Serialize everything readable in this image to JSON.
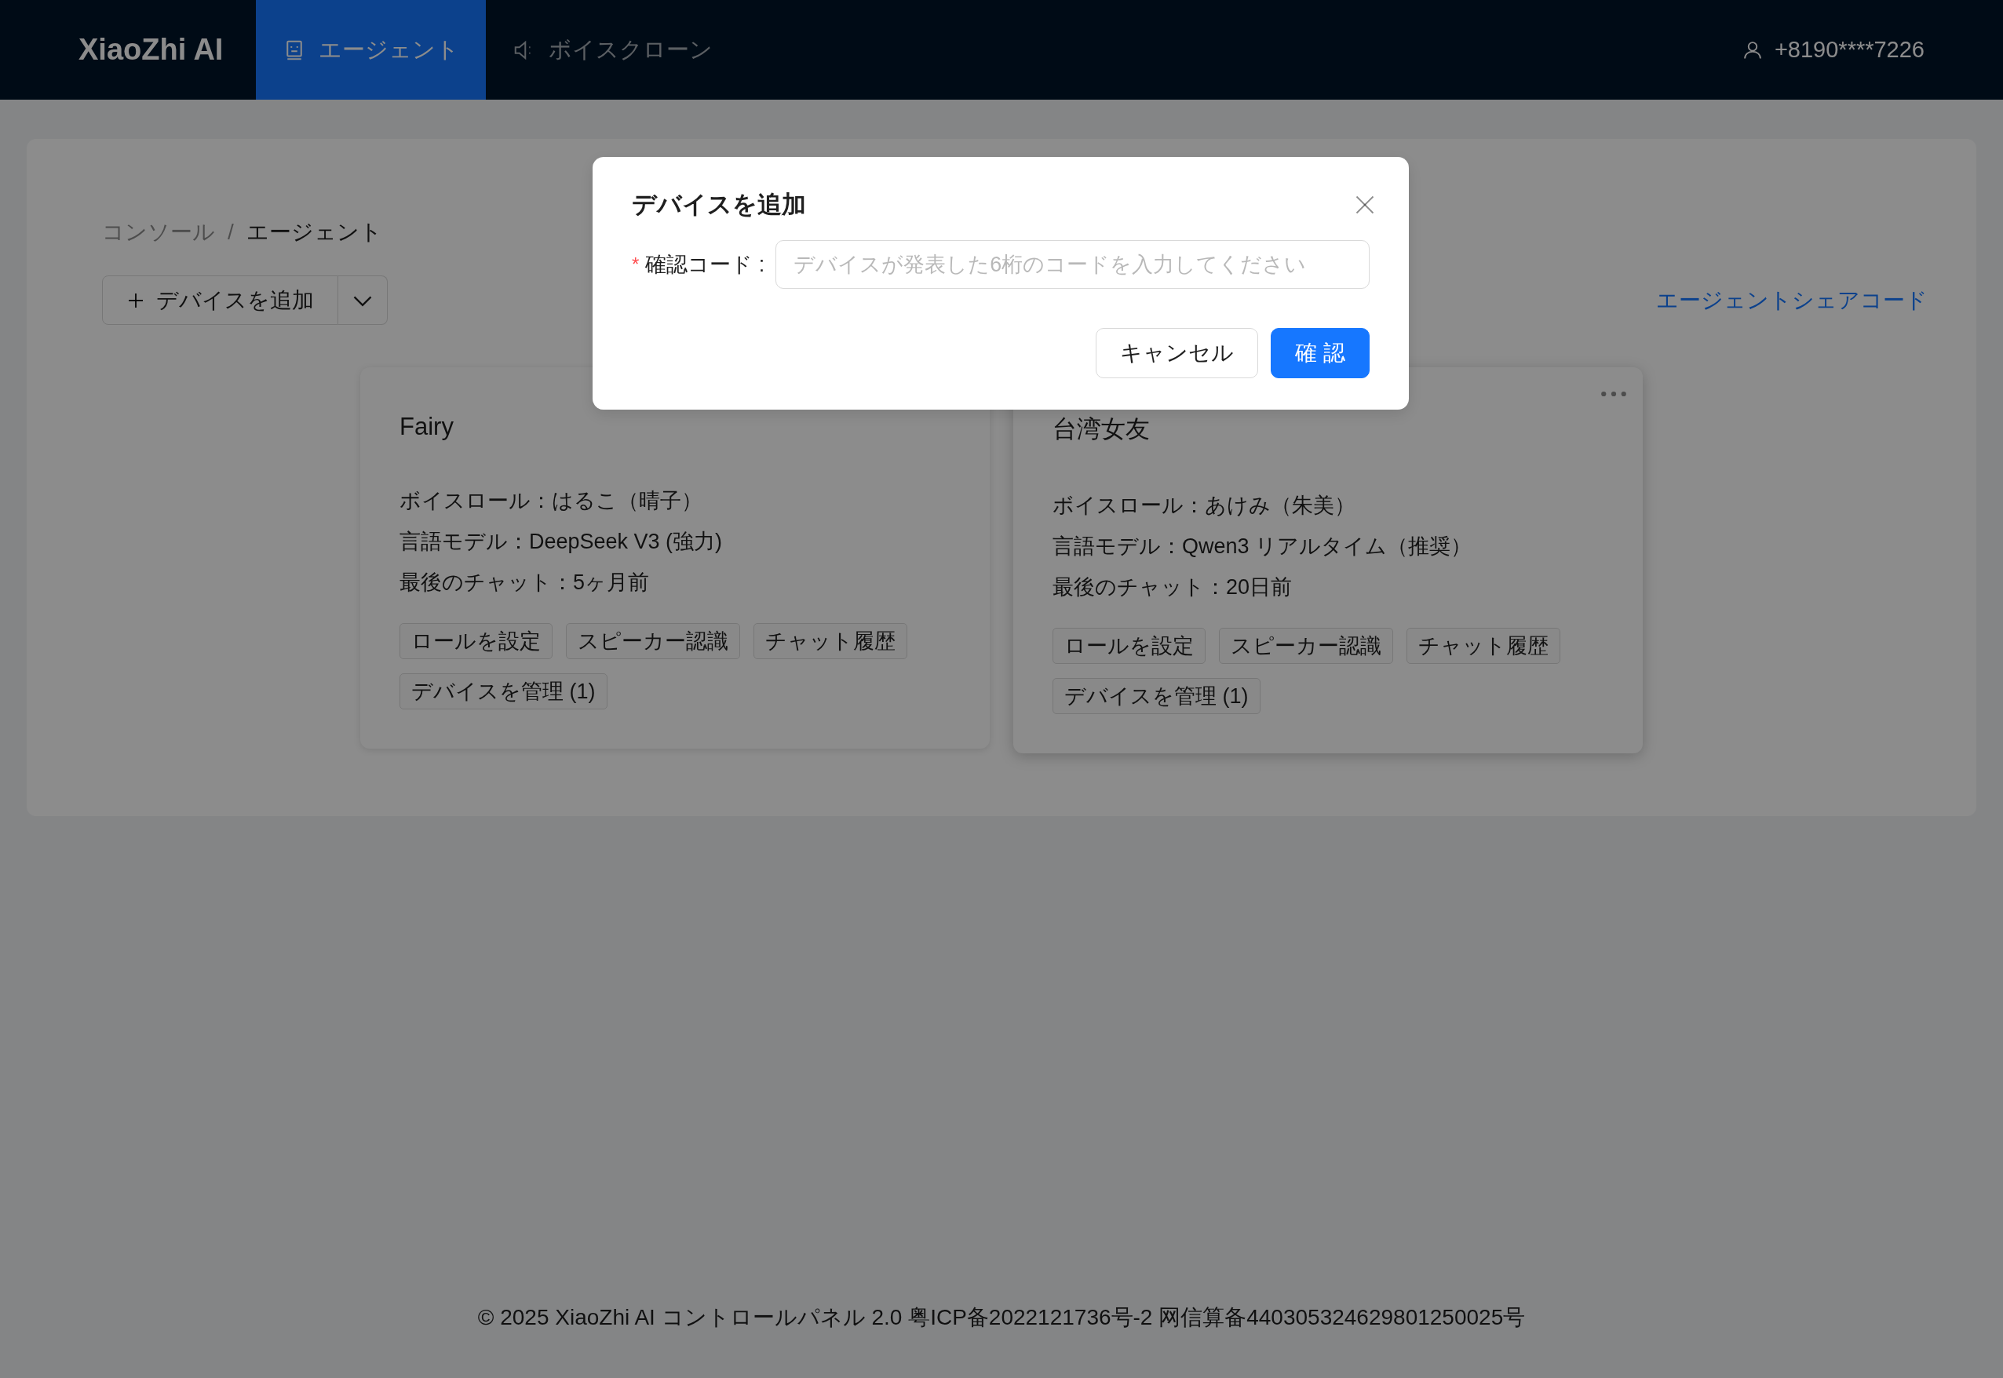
{
  "header": {
    "logo": "XiaoZhi AI",
    "nav": [
      {
        "label": "エージェント",
        "selected": true
      },
      {
        "label": "ボイスクローン",
        "selected": false
      }
    ],
    "user": "+8190****7226"
  },
  "breadcrumb": [
    "コンソール",
    "エージェント"
  ],
  "breadcrumb_separator": "/",
  "add_button": {
    "label": "デバイスを追加"
  },
  "share_link": "エージェントシェアコード",
  "agents": [
    {
      "name": "Fairy",
      "menu_visible": false,
      "lines": [
        "ボイスロール：はるこ（晴子）",
        "言語モデル：DeepSeek V3 (強力)",
        "最後のチャット：5ヶ月前"
      ],
      "actions": [
        "ロールを設定",
        "スピーカー認識",
        "チャット履歴",
        "デバイスを管理 (1)"
      ]
    },
    {
      "name": "台湾女友",
      "menu_visible": true,
      "lines": [
        "ボイスロール：あけみ（朱美）",
        "言語モデル：Qwen3 リアルタイム（推奨）",
        "最後のチャット：20日前"
      ],
      "actions": [
        "ロールを設定",
        "スピーカー認識",
        "チャット履歴",
        "デバイスを管理 (1)"
      ]
    }
  ],
  "footer": "© 2025 XiaoZhi AI コントロールパネル 2.0 粤ICP备2022121736号-2 网信算备440305324629801250025号",
  "dialog": {
    "title": "デバイスを追加",
    "field": {
      "required_mark": "*",
      "label": "確認コード :",
      "placeholder": "デバイスが発表した6桁のコードを入力してください"
    },
    "buttons": [
      {
        "label": "キャンセル",
        "kind": "default"
      },
      {
        "label": "確 認",
        "kind": "primary"
      }
    ]
  }
}
